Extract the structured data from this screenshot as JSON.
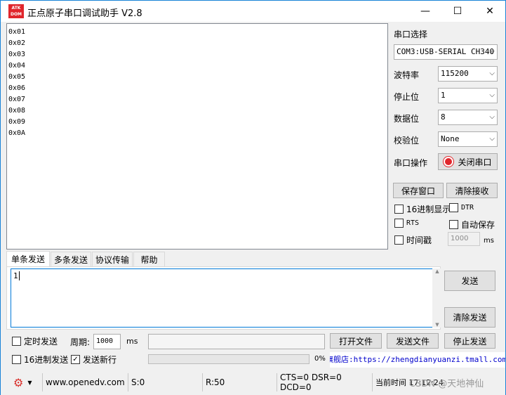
{
  "window": {
    "logo_text": "ATK\nDOM",
    "title": "正点原子串口调试助手 V2.8",
    "minimize_glyph": "—",
    "maximize_glyph": "☐",
    "close_glyph": "✕"
  },
  "receive": {
    "lines": [
      "0x01",
      "0x02",
      "0x03",
      "0x04",
      "0x05",
      "0x06",
      "0x07",
      "0x08",
      "0x09",
      "0x0A"
    ]
  },
  "settings": {
    "port_select_label": "串口选择",
    "port_value": "COM3:USB-SERIAL CH340",
    "baud_label": "波特率",
    "baud_value": "115200",
    "stop_label": "停止位",
    "stop_value": "1",
    "data_label": "数据位",
    "data_value": "8",
    "parity_label": "校验位",
    "parity_value": "None",
    "op_label": "串口操作",
    "close_port_button": "关闭串口",
    "save_window_button": "保存窗口",
    "clear_receive_button": "清除接收",
    "hex_display_label": "16进制显示",
    "dtr_label": "DTR",
    "rts_label": "RTS",
    "auto_save_label": "自动保存",
    "timestamp_label": "时间戳",
    "timestamp_interval": "1000",
    "timestamp_unit": "ms"
  },
  "tabs": [
    {
      "label": "单条发送"
    },
    {
      "label": "多条发送"
    },
    {
      "label": "协议传输"
    },
    {
      "label": "帮助"
    }
  ],
  "send": {
    "text": "1",
    "send_button": "发送",
    "clear_send_button": "清除发送",
    "timed_send_label": "定时发送",
    "period_label": "周期:",
    "period_value": "1000",
    "period_unit": "ms",
    "open_file_button": "打开文件",
    "send_file_button": "发送文件",
    "stop_send_button": "停止发送",
    "hex_send_label": "16进制发送",
    "send_newline_label": "发送新行",
    "send_newline_checked": "✓",
    "progress_text": "0%",
    "progress_fraction": 0,
    "shop_link": "天猫旗舰店:https://zhengdianyuanzi.tmall.com"
  },
  "status": {
    "website": "www.openedv.com",
    "sent": "S:0",
    "received": "R:50",
    "lines": "CTS=0 DSR=0 DCD=0",
    "time": "当前时间 17:12:24",
    "watermark": "CSDN @天地神仙"
  },
  "colors": {
    "accent": "#0078d7",
    "indicator_red": "#e0262c",
    "link_blue": "#0000cc"
  }
}
